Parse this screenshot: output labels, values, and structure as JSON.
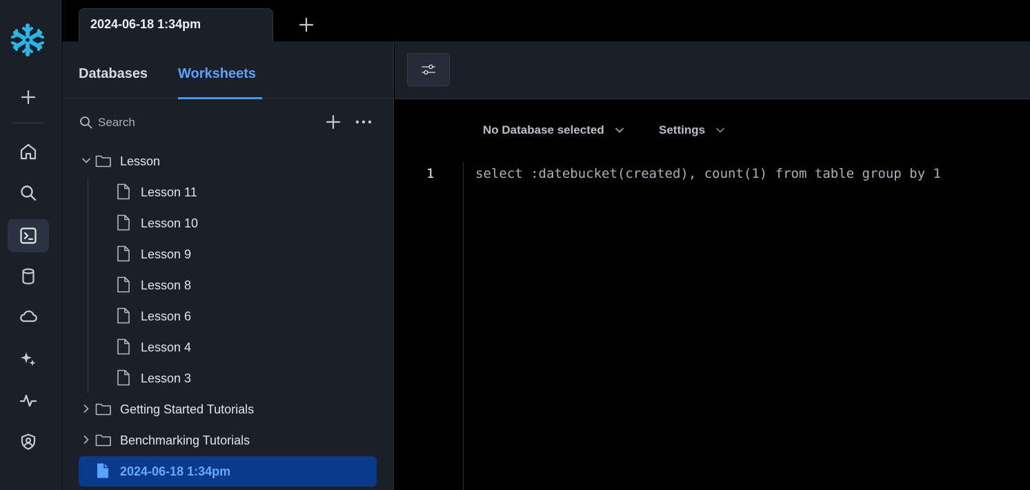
{
  "tabs": {
    "active_tab_label": "2024-06-18 1:34pm"
  },
  "panel": {
    "tab_databases": "Databases",
    "tab_worksheets": "Worksheets",
    "search_placeholder": "Search"
  },
  "tree": {
    "folder_lesson": "Lesson",
    "lessons": [
      "Lesson 11",
      "Lesson 10",
      "Lesson 9",
      "Lesson 8",
      "Lesson 6",
      "Lesson 4",
      "Lesson 3"
    ],
    "folder_getting_started": "Getting Started Tutorials",
    "folder_benchmarking": "Benchmarking Tutorials",
    "selected_worksheet": "2024-06-18 1:34pm"
  },
  "editor": {
    "database_selector": "No Database selected",
    "settings_label": "Settings",
    "line_number": "1",
    "code_line": "select :datebucket(created), count(1) from table group by 1"
  },
  "colors": {
    "accent": "#4d94ff",
    "selected_bg": "#0a3a8c",
    "panel_bg": "#1b1f27",
    "logo": "#29b5e8"
  }
}
